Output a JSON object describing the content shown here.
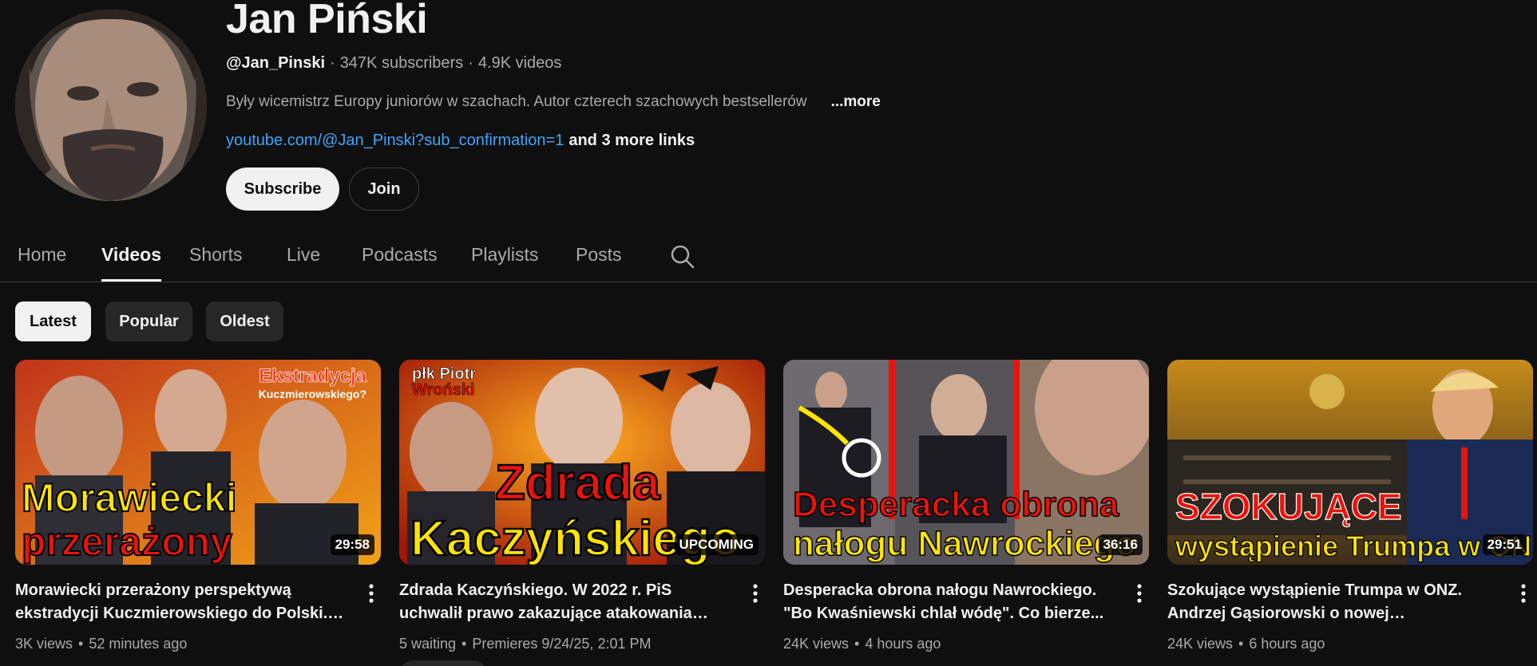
{
  "channel": {
    "name": "Jan Piński",
    "handle": "@Jan_Pinski",
    "subscribers": "347K subscribers",
    "videos": "4.9K videos",
    "description": "Były wicemistrz Europy juniorów w szachach. Autor czterech szachowych bestsellerów",
    "more_label": "...more",
    "link_url": "youtube.com/@Jan_Pinski?sub_confirmation=1",
    "more_links": "and 3 more links",
    "subscribe_label": "Subscribe",
    "join_label": "Join"
  },
  "tabs": [
    {
      "label": "Home",
      "active": false
    },
    {
      "label": "Videos",
      "active": true
    },
    {
      "label": "Shorts",
      "active": false
    },
    {
      "label": "Live",
      "active": false
    },
    {
      "label": "Podcasts",
      "active": false
    },
    {
      "label": "Playlists",
      "active": false
    },
    {
      "label": "Posts",
      "active": false
    }
  ],
  "search_icon": "search-icon",
  "chips": [
    {
      "label": "Latest",
      "selected": true
    },
    {
      "label": "Popular",
      "selected": false
    },
    {
      "label": "Oldest",
      "selected": false
    }
  ],
  "videos": [
    {
      "title": "Morawiecki przerażony perspektywą ekstradycji Kuczmierowskiego do Polski. T....",
      "views": "3K views",
      "time": "52 minutes ago",
      "badge": "29:58",
      "thumb_text": {
        "line1": "Morawiecki",
        "line2": "przerażony",
        "top1": "Ekstradycja",
        "top2": "Kuczmierowskiego?"
      }
    },
    {
      "title": "Zdrada Kaczyńskiego. W 2022 r. PiS uchwalił prawo zakazujące atakowania rosyjskich...",
      "views": "5 waiting",
      "time": "Premieres 9/24/25, 2:01 PM",
      "badge": "UPCOMING",
      "thumb_text": {
        "line1": "Zdrada",
        "line2": "Kaczyńskiego",
        "top1": "płk Piotr",
        "top2": "Wroński"
      }
    },
    {
      "title": "Desperacka obrona nałogu Nawrockiego. \"Bo Kwaśniewski chlał wódę\". Co bierze...",
      "views": "24K views",
      "time": "4 hours ago",
      "badge": "36:16",
      "thumb_text": {
        "line1": "Desperacka obrona",
        "line2": "nałogu Nawrockiego"
      }
    },
    {
      "title": "Szokujące wystąpienie Trumpa w ONZ. Andrzej Gąsiorowski o nowej amerykański...",
      "views": "24K views",
      "time": "6 hours ago",
      "badge": "29:51",
      "thumb_text": {
        "line1": "SZOKUJĄCE",
        "line2": "wystąpienie Trumpa w ONZ"
      }
    }
  ],
  "colors": {
    "background": "#0f0f0f",
    "text_primary": "#f1f1f1",
    "text_secondary": "#aaaaaa",
    "link": "#3ea6ff",
    "chip_bg": "#272727",
    "thumb_yellow": "#ffe400",
    "thumb_red": "#e8140c"
  }
}
